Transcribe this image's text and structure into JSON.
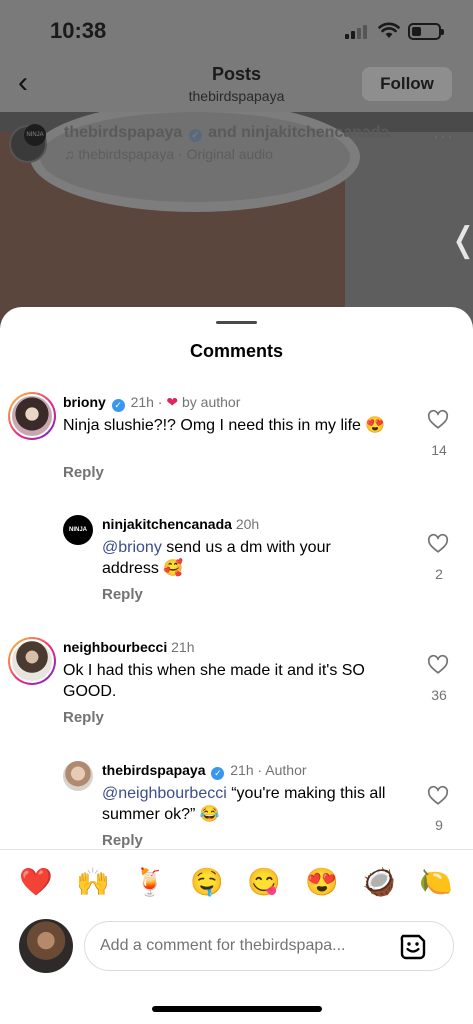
{
  "status_bar": {
    "time": "10:38"
  },
  "nav": {
    "title": "Posts",
    "subtitle": "thebirdspapaya",
    "follow_label": "Follow"
  },
  "post": {
    "users": "thebirdspapaya",
    "and_text": "and ninjakitchencanada",
    "audio": "thebirdspapaya · Original audio",
    "avatar2_text": "NINJA"
  },
  "sheet": {
    "title": "Comments"
  },
  "comments": [
    {
      "username": "briony",
      "time": "21h ·",
      "liked_by_author": "by author",
      "text": "Ninja slushie?!? Omg I need this in my life 😍",
      "reply_label": "Reply",
      "likes": "14"
    },
    {
      "username": "ninjakitchencanada",
      "time": "20h",
      "mention": "@briony",
      "text": " send us a dm with your address 🥰",
      "reply_label": "Reply",
      "likes": "2",
      "avatar_text": "NINJA"
    },
    {
      "username": "neighbourbecci",
      "time": "21h",
      "text": "Ok I had this when she made it and it's SO GOOD.",
      "reply_label": "Reply",
      "likes": "36"
    },
    {
      "username": "thebirdspapaya",
      "time": "21h · Author",
      "mention": "@neighbourbecci",
      "text": " “you're making this all summer ok?” 😂",
      "reply_label": "Reply",
      "likes": "9"
    }
  ],
  "emojis": [
    "❤️",
    "🙌",
    "🍹",
    "🤤",
    "😋",
    "😍",
    "🥥",
    "🍋"
  ],
  "composer": {
    "placeholder": "Add a comment for thebirdspapa..."
  }
}
